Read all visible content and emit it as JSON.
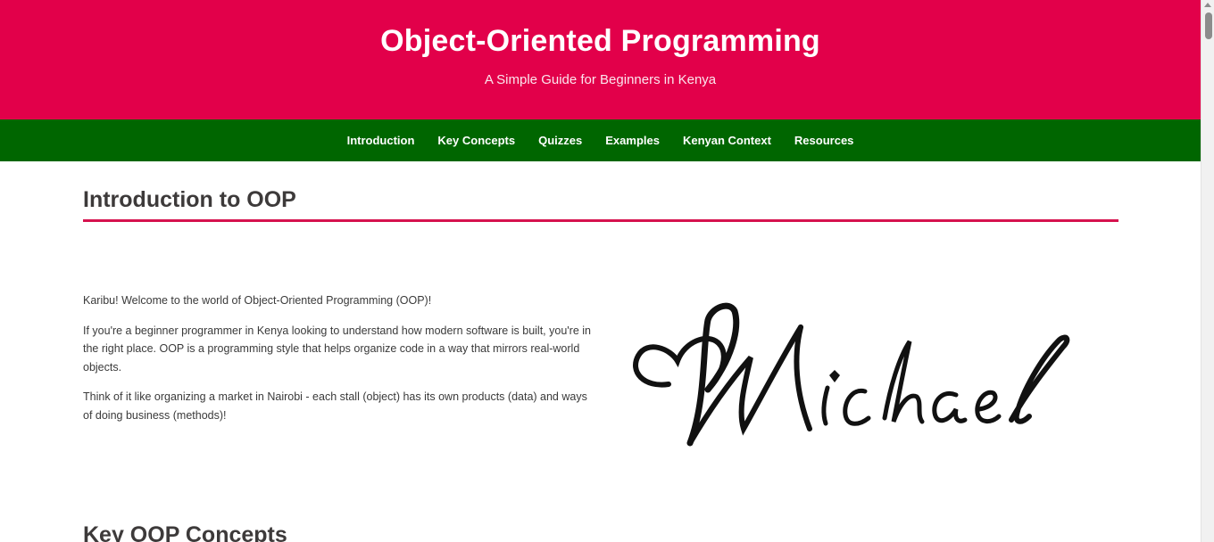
{
  "header": {
    "title": "Object-Oriented Programming",
    "subtitle": "A Simple Guide for Beginners in Kenya",
    "background_color": "#e2004a"
  },
  "nav": {
    "background_color": "#006600",
    "items": [
      {
        "label": "Introduction"
      },
      {
        "label": "Key Concepts"
      },
      {
        "label": "Quizzes"
      },
      {
        "label": "Examples"
      },
      {
        "label": "Kenyan Context"
      },
      {
        "label": "Resources"
      }
    ]
  },
  "intro": {
    "heading": "Introduction to OOP",
    "accent_color": "#d6124e",
    "paragraphs": [
      "Karibu! Welcome to the world of Object-Oriented Programming (OOP)!",
      "If you're a beginner programmer in Kenya looking to understand how modern software is built, you're in the right place. OOP is a programming style that helps organize code in a way that mirrors real-world objects.",
      "Think of it like organizing a market in Nairobi - each stall (object) has its own products (data) and ways of doing business (methods)!"
    ],
    "signature_image": {
      "text": "Michael",
      "icon": "heart-signature-logo"
    }
  },
  "next_section": {
    "heading": "Key OOP Concepts"
  }
}
